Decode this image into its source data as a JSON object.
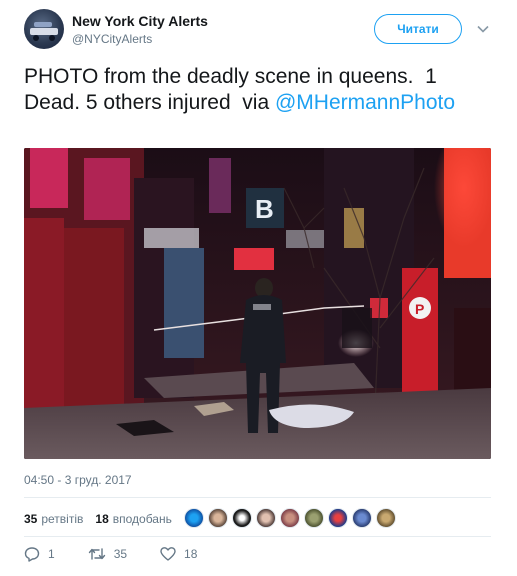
{
  "account": {
    "name": "New York City Alerts",
    "handle": "@NYCityAlerts"
  },
  "follow_button": {
    "label": "Читати"
  },
  "tweet": {
    "text_main": "PHOTO from the deadly scene in queens.  1 Dead. 5 others injured  via ",
    "mention": "@MHermannPhoto",
    "timestamp": "04:50 - 3 груд. 2017"
  },
  "stats": {
    "retweets_count": "35",
    "retweets_label": "ретвітів",
    "likes_count": "18",
    "likes_label": "вподобань"
  },
  "actions": {
    "reply_count": "1",
    "retweet_count": "35",
    "like_count": "18"
  },
  "colors": {
    "accent": "#1da1f2",
    "text": "#14171a",
    "muted": "#657786"
  },
  "icons": {
    "reply": "reply-icon",
    "retweet": "retweet-icon",
    "like": "heart-icon",
    "more": "chevron-down-icon"
  }
}
